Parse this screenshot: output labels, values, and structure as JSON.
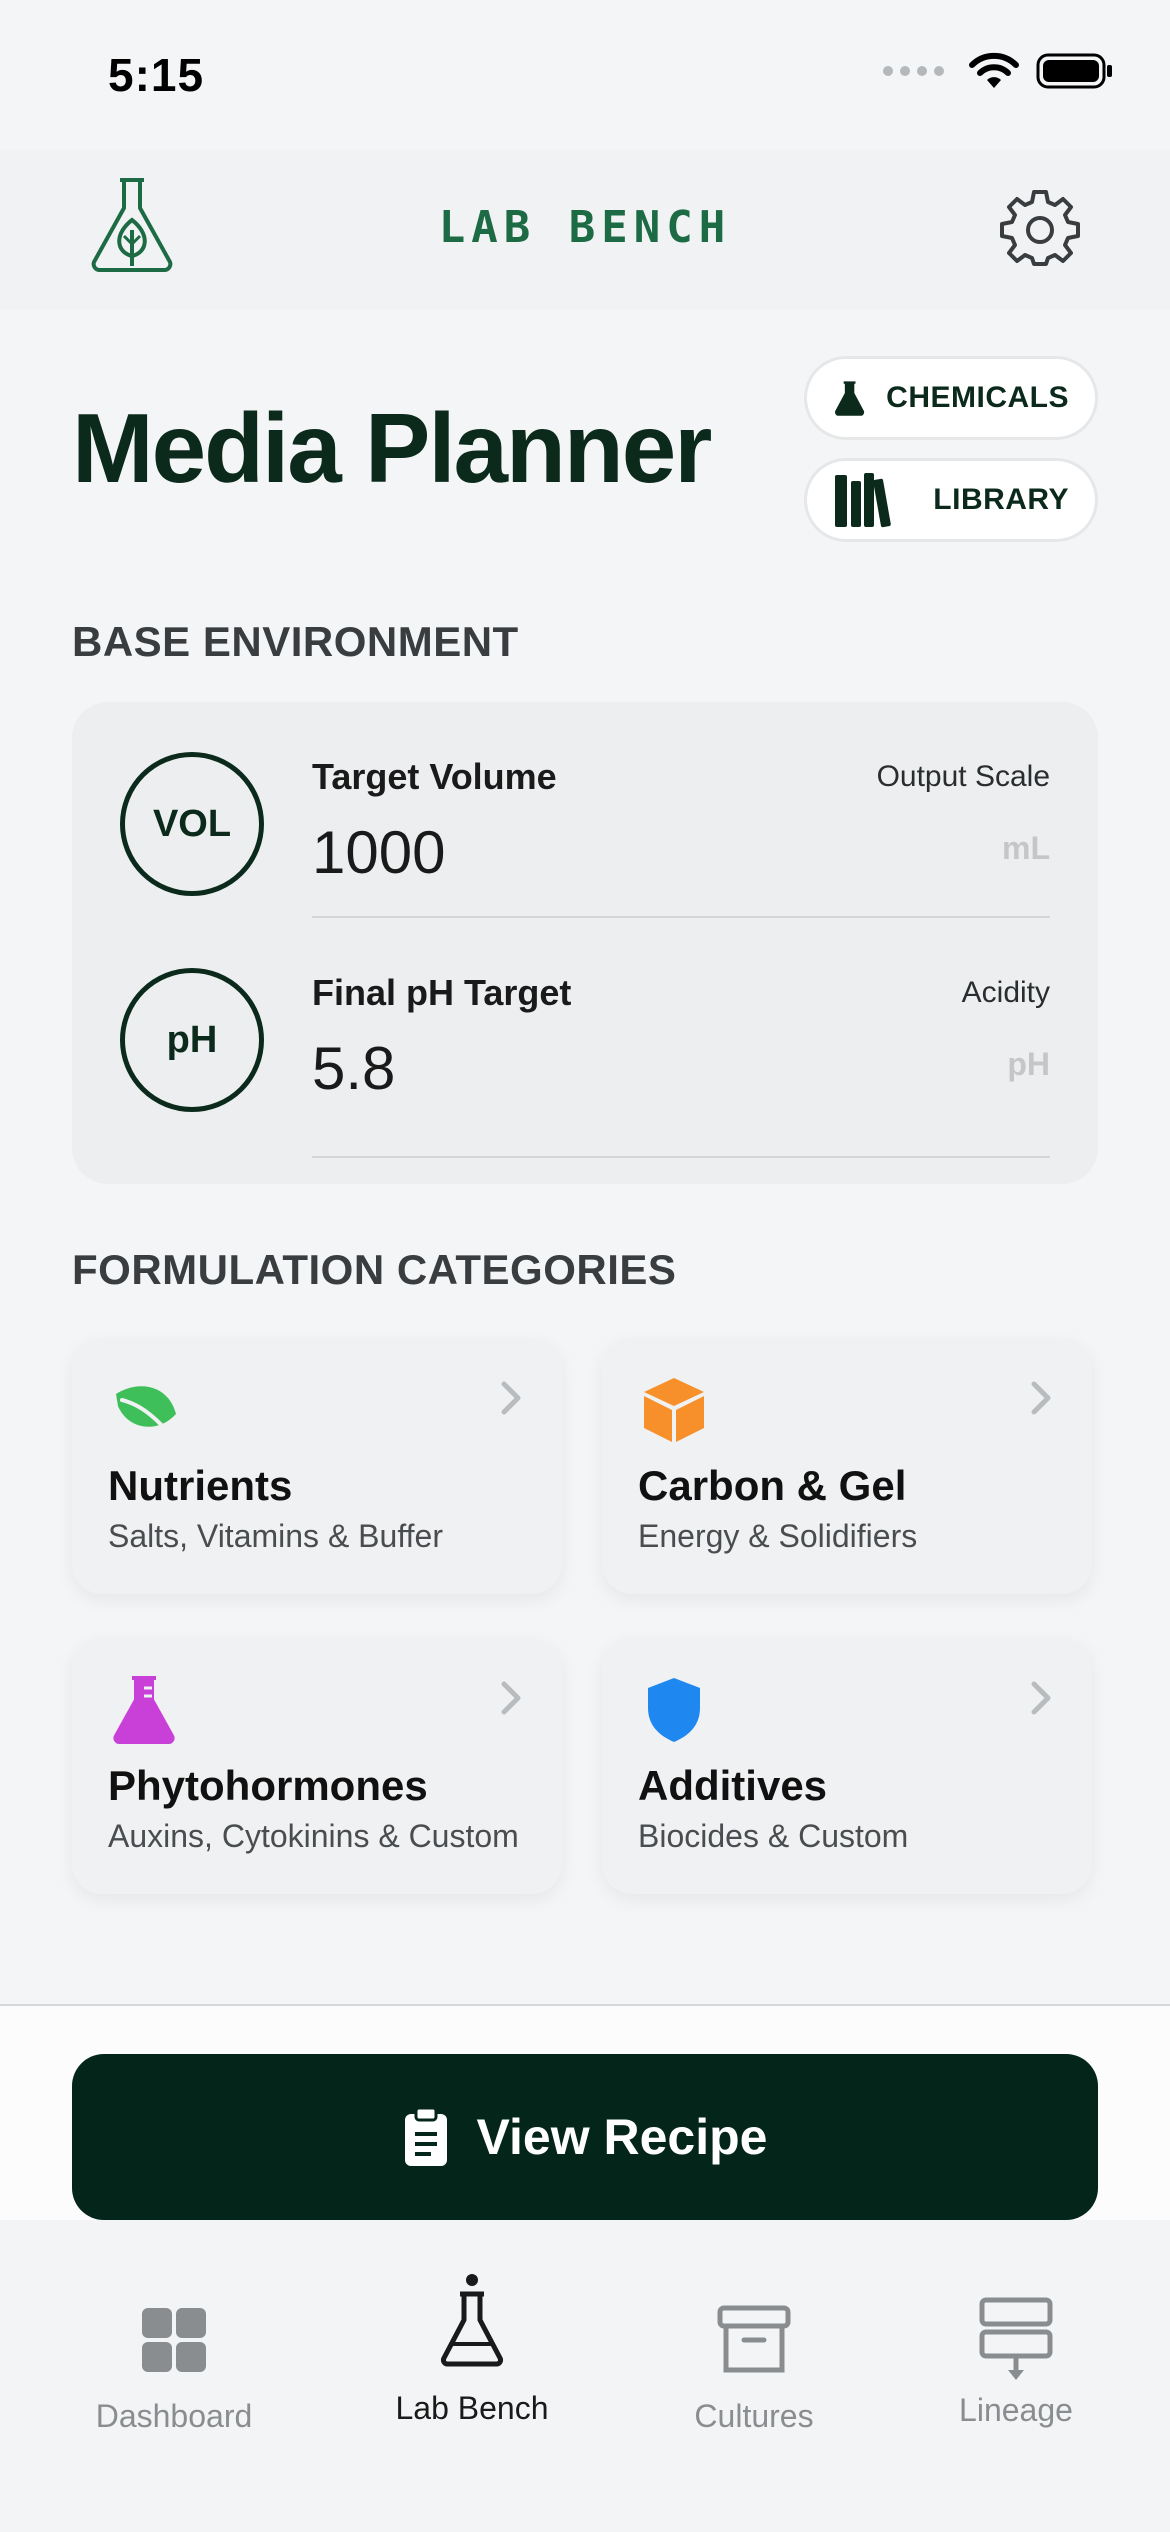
{
  "status_bar": {
    "time": "5:15"
  },
  "header": {
    "title": "LAB BENCH"
  },
  "page": {
    "title": "Media Planner",
    "chemicals_label": "CHEMICALS",
    "library_label": "LIBRARY"
  },
  "base_environment": {
    "heading": "BASE ENVIRONMENT",
    "rows": [
      {
        "badge": "VOL",
        "label": "Target Volume",
        "value": "1000",
        "caption": "Output Scale",
        "unit": "mL"
      },
      {
        "badge": "pH",
        "label": "Final pH Target",
        "value": "5.8",
        "caption": "Acidity",
        "unit": "pH"
      }
    ]
  },
  "formulation": {
    "heading": "FORMULATION CATEGORIES",
    "categories": [
      {
        "title": "Nutrients",
        "subtitle": "Salts, Vitamins & Buffer",
        "icon": "leaf-icon",
        "color": "#3fbf5a"
      },
      {
        "title": "Carbon & Gel",
        "subtitle": "Energy & Solidifiers",
        "icon": "cube-icon",
        "color": "#f7902a"
      },
      {
        "title": "Phytohormones",
        "subtitle": "Auxins, Cytokinins & Custom",
        "icon": "flask-icon",
        "color": "#c940d8"
      },
      {
        "title": "Additives",
        "subtitle": "Biocides & Custom",
        "icon": "shield-icon",
        "color": "#1e88f0"
      }
    ]
  },
  "actions": {
    "view_recipe": "View Recipe"
  },
  "tabbar": {
    "items": [
      {
        "label": "Dashboard",
        "icon": "grid-icon",
        "active": false
      },
      {
        "label": "Lab Bench",
        "icon": "flask-icon",
        "active": true
      },
      {
        "label": "Cultures",
        "icon": "archive-icon",
        "active": false
      },
      {
        "label": "Lineage",
        "icon": "lineage-icon",
        "active": false
      }
    ]
  },
  "colors": {
    "brand_dark": "#04261a",
    "brand_green": "#1c6b45"
  }
}
